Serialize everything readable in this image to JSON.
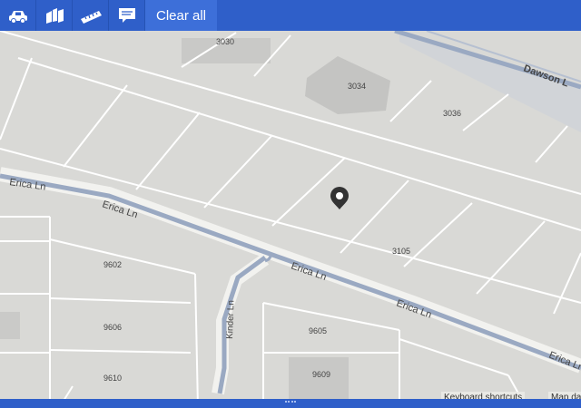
{
  "toolbar": {
    "buttons": [
      {
        "icon": "car-icon"
      },
      {
        "icon": "map-pieces-icon"
      },
      {
        "icon": "ruler-icon"
      },
      {
        "icon": "speech-bubble-icon"
      }
    ],
    "clear_label": "Clear all"
  },
  "map": {
    "streets": {
      "erica_top": "Erica Ln",
      "erica_1": "Erica Ln",
      "erica_2": "Erica Ln",
      "erica_3": "Erica Ln",
      "erica_4": "Erica Ln",
      "kinder": "Kinder Ln",
      "dawson": "Dawson L"
    },
    "lots": {
      "l3030": "3030",
      "l3034": "3034",
      "l3036": "3036",
      "l3105": "3105",
      "l9602": "9602",
      "l9606": "9606",
      "l9610": "9610",
      "l9605": "9605",
      "l9609": "9609"
    },
    "attribution": {
      "keyboard": "Keyboard shortcuts",
      "mapdata": "Map da"
    }
  },
  "colors": {
    "toolbar": "#2f5fc9",
    "clear_button": "#3d6fd9",
    "road": "#9aa9c2",
    "lot_line": "#ffffff",
    "map_bg": "#d9d9d6"
  }
}
